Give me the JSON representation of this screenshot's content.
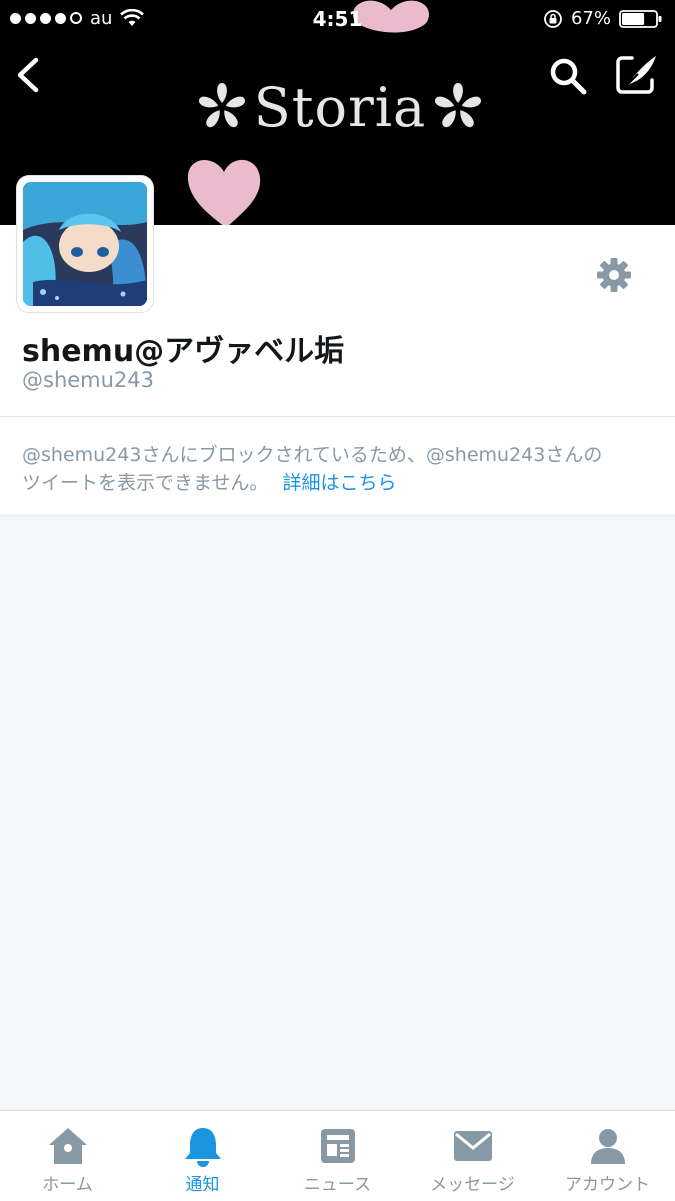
{
  "status_bar": {
    "carrier": "au",
    "time": "4:51",
    "battery": "67%",
    "signal_bars_filled": 4,
    "signal_bars_total": 5,
    "battery_level": 0.67
  },
  "header": {
    "banner_text": "Storia",
    "icons": {
      "back": "chevron-left-icon",
      "search": "search-icon",
      "compose": "compose-quill-icon"
    }
  },
  "profile": {
    "display_name": "shemu@アヴァベル垢",
    "handle": "@shemu243",
    "settings_icon": "gear-icon"
  },
  "blocked_notice": {
    "line1": "@shemu243さんにブロックされているため、@shemu243さんの",
    "line2": "ツイートを表示できません。",
    "link": "詳細はこちら"
  },
  "tab_bar": {
    "active": "notifications",
    "tabs": [
      {
        "id": "home",
        "label": "ホーム",
        "icon": "home-icon"
      },
      {
        "id": "notifications",
        "label": "通知",
        "icon": "bell-icon"
      },
      {
        "id": "news",
        "label": "ニュース",
        "icon": "news-icon"
      },
      {
        "id": "messages",
        "label": "メッセージ",
        "icon": "envelope-icon"
      },
      {
        "id": "account",
        "label": "アカウント",
        "icon": "person-icon"
      }
    ]
  },
  "colors": {
    "accent": "#1b95e0",
    "muted": "#8899a6",
    "text": "#14171a",
    "background": "#f4f7fa",
    "petal_pink": "#f6c6d8"
  }
}
